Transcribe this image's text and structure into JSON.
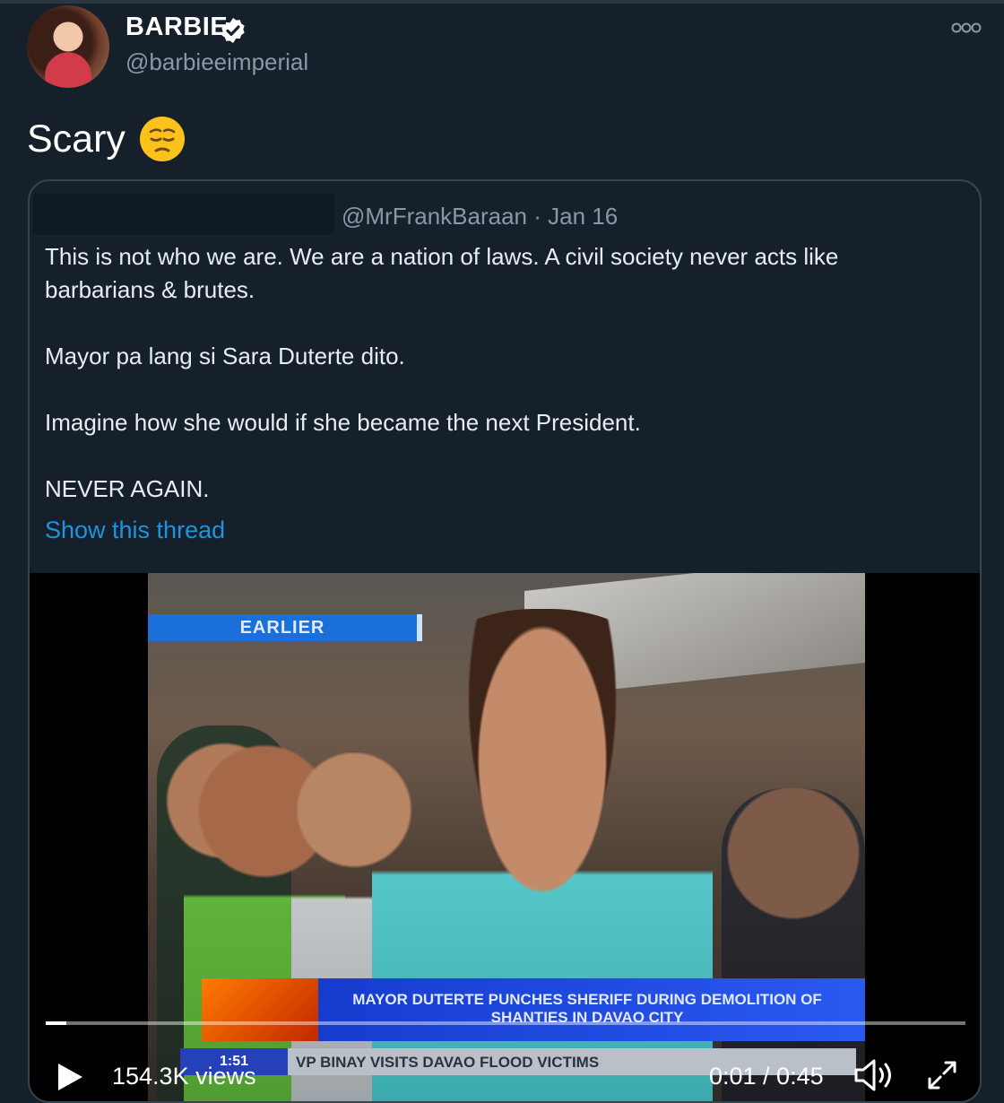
{
  "tweet": {
    "display_name": "BARBIE",
    "handle": "@barbieeimperial",
    "text": "Scary",
    "emoji_icon": "pensive-face-emoji"
  },
  "quoted_tweet": {
    "meta": "@MrFrankBaraan · Jan 16",
    "paragraphs": [
      "This is not who we are. We are a nation of laws. A civil society never acts like barbarians & brutes.",
      "Mayor pa lang si Sara Duterte dito.",
      "Imagine how she would if she became the next President.",
      "NEVER AGAIN."
    ],
    "show_thread": "Show this thread"
  },
  "video": {
    "overlay_tag": "EARLIER",
    "headline": "MAYOR DUTERTE PUNCHES SHERIFF DURING DEMOLITION OF SHANTIES IN DAVAO CITY",
    "ticker_time": "1:51",
    "ticker_text": "VP BINAY VISITS DAVAO FLOOD VICTIMS",
    "views": "154.3K views",
    "time": "0:01 / 0:45",
    "progress_fraction": 0.022
  },
  "colors": {
    "background": "#15202b",
    "link": "#1b95e0",
    "secondary_text": "#8899a6",
    "border": "#38444d"
  }
}
